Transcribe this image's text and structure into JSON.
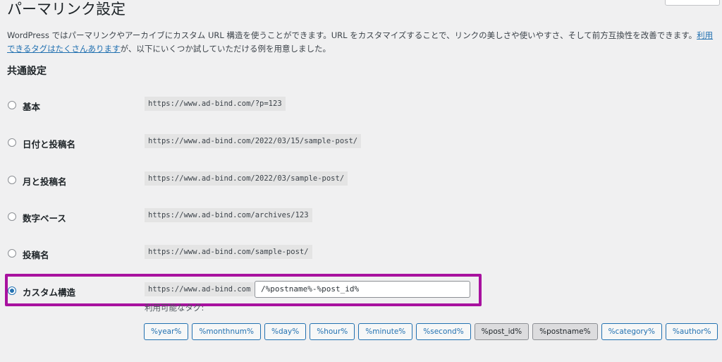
{
  "page": {
    "title": "パーマリンク設定",
    "intro_text": "WordPress ではパーマリンクやアーカイブにカスタム URL 構造を使うことができます。URL をカスタマイズすることで、リンクの美しさや使いやすさ、そして前方互換性を改善できます。",
    "intro_link": "利用できるタグはたくさんあります",
    "intro_tail": "が、以下にいくつか試していただける例を用意しました。"
  },
  "common": {
    "title": "共通設定",
    "options": [
      {
        "label": "基本",
        "example": "https://www.ad-bind.com/?p=123",
        "checked": false
      },
      {
        "label": "日付と投稿名",
        "example": "https://www.ad-bind.com/2022/03/15/sample-post/",
        "checked": false
      },
      {
        "label": "月と投稿名",
        "example": "https://www.ad-bind.com/2022/03/sample-post/",
        "checked": false
      },
      {
        "label": "数字ベース",
        "example": "https://www.ad-bind.com/archives/123",
        "checked": false
      },
      {
        "label": "投稿名",
        "example": "https://www.ad-bind.com/sample-post/",
        "checked": false
      }
    ],
    "custom": {
      "label": "カスタム構造",
      "base": "https://www.ad-bind.com",
      "value": "/%postname%-%post_id%",
      "checked": true,
      "available_tags_label": "利用可能なタグ:"
    }
  },
  "tags": [
    {
      "label": "%year%",
      "active": false
    },
    {
      "label": "%monthnum%",
      "active": false
    },
    {
      "label": "%day%",
      "active": false
    },
    {
      "label": "%hour%",
      "active": false
    },
    {
      "label": "%minute%",
      "active": false
    },
    {
      "label": "%second%",
      "active": false
    },
    {
      "label": "%post_id%",
      "active": true
    },
    {
      "label": "%postname%",
      "active": true
    },
    {
      "label": "%category%",
      "active": false
    },
    {
      "label": "%author%",
      "active": false
    }
  ],
  "colors": {
    "accent": "#2271b1",
    "highlight_border": "#a8119f"
  }
}
